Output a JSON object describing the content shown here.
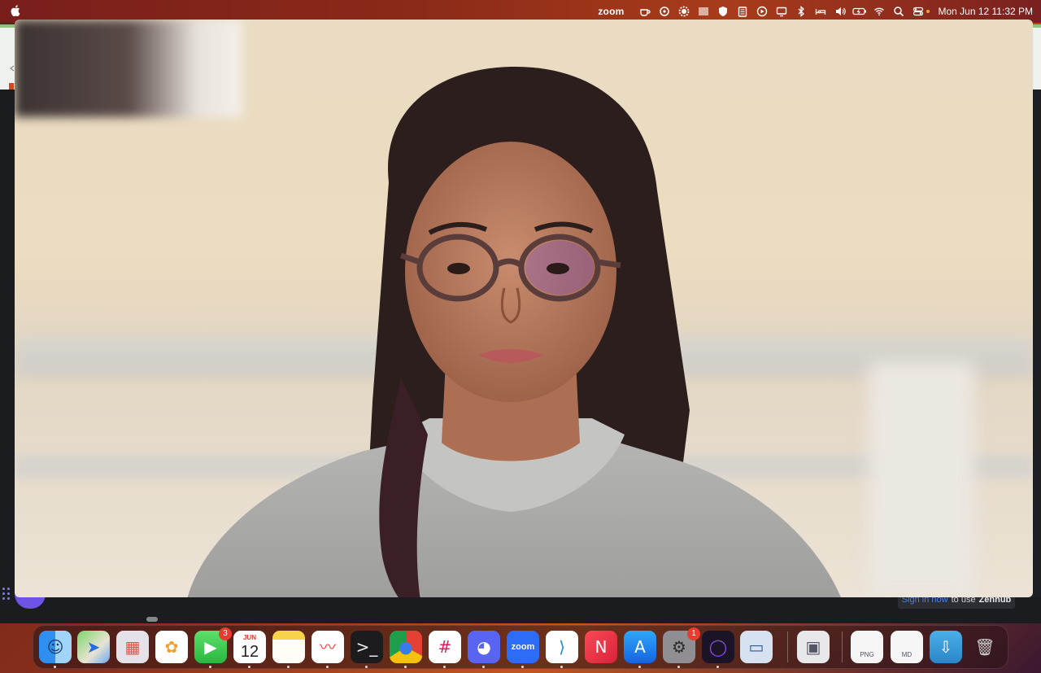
{
  "menubar": {
    "app_name": "zoom",
    "clock": "Mon Jun 12  11:32 PM",
    "status_icons": [
      "cup-icon",
      "lastpass-icon",
      "gear-icon",
      "barcode-icon",
      "shield-icon",
      "clipboard-icon",
      "play-icon",
      "display-icon",
      "bluetooth-icon",
      "bed-icon",
      "volume-icon",
      "battery-icon",
      "wifi-icon",
      "search-icon",
      "control-center-icon"
    ]
  },
  "background_app": {
    "hint_link": "Sign in now",
    "hint_text": "to use",
    "hint_app": "Zenhub"
  },
  "video": {
    "description_icon": "participant-video"
  },
  "dock": {
    "apps": [
      {
        "name": "Finder",
        "icon": "finder-icon"
      },
      {
        "name": "Maps",
        "icon": "maps-icon"
      },
      {
        "name": "Launchpad",
        "icon": "launchpad-icon"
      },
      {
        "name": "Photos",
        "icon": "photos-icon"
      },
      {
        "name": "FaceTime",
        "icon": "facetime-icon",
        "badge": "3"
      },
      {
        "name": "Calendar",
        "icon": "calendar-icon",
        "month": "JUN",
        "day": "12"
      },
      {
        "name": "Notes",
        "icon": "notes-icon"
      },
      {
        "name": "Freeform",
        "icon": "freeform-icon"
      },
      {
        "name": "Terminal",
        "icon": "terminal-icon"
      },
      {
        "name": "Chrome",
        "icon": "chrome-icon"
      },
      {
        "name": "Slack",
        "icon": "slack-icon"
      },
      {
        "name": "Discord",
        "icon": "discord-icon"
      },
      {
        "name": "Zoom",
        "icon": "zoom-icon",
        "label": "zoom"
      },
      {
        "name": "VS Code",
        "icon": "vscode-icon"
      },
      {
        "name": "News",
        "icon": "news-icon"
      },
      {
        "name": "App Store",
        "icon": "appstore-icon"
      },
      {
        "name": "System Settings",
        "icon": "settings-icon",
        "badge": "1"
      },
      {
        "name": "Arc",
        "icon": "arc-icon"
      },
      {
        "name": "Screen Sharing",
        "icon": "screen-icon"
      },
      {
        "name": "Preview",
        "icon": "preview-icon"
      },
      {
        "name": "PNG file",
        "icon": "png-file-icon",
        "label": "PNG"
      },
      {
        "name": "MD file",
        "icon": "md-file-icon",
        "label": "MD"
      },
      {
        "name": "Downloads",
        "icon": "downloads-icon"
      },
      {
        "name": "Trash",
        "icon": "trash-icon"
      }
    ]
  }
}
